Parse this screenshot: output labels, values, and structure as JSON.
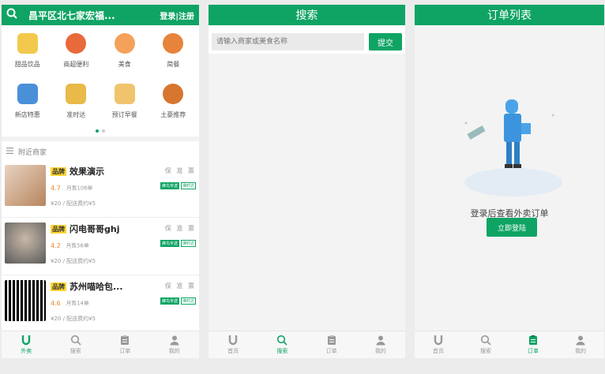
{
  "home": {
    "location": "昌平区北七家宏福...",
    "login_label": "登录|注册",
    "categories": [
      {
        "label": "甜品饮品",
        "color": "#f2c94c"
      },
      {
        "label": "商超便利",
        "color": "#e86a3a"
      },
      {
        "label": "美食",
        "color": "#f4a25b"
      },
      {
        "label": "简餐",
        "color": "#e7833b"
      },
      {
        "label": "新店特惠",
        "color": "#4a90d9"
      },
      {
        "label": "准时达",
        "color": "#e9b949"
      },
      {
        "label": "预订早餐",
        "color": "#f0c46d"
      },
      {
        "label": "土豪推荐",
        "color": "#d7762f"
      }
    ],
    "nearby_title": "附近商家",
    "brand_label": "品牌",
    "service_tags": "保 准 票",
    "shops": [
      {
        "name": "效果演示",
        "rating": "4.7",
        "sold": "月售106单",
        "fee": "¥20 / 配送费约¥5",
        "badge1": "蜂鸟专送",
        "badge2": "准时达",
        "thumb": "#c6a78d"
      },
      {
        "name": "闪电哥哥ghj",
        "rating": "4.2",
        "sold": "月售56单",
        "fee": "¥20 / 配送费约¥5",
        "badge1": "蜂鸟专送",
        "badge2": "准时达",
        "thumb": "#7d7d7d"
      },
      {
        "name": "苏州喵哈包...",
        "rating": "4.6",
        "sold": "月售14单",
        "fee": "¥20 / 配送费约¥5",
        "badge1": "蜂鸟专送",
        "badge2": "准时达",
        "thumb": "#222222"
      }
    ]
  },
  "search": {
    "title": "搜索",
    "placeholder": "请输入商家或美食名称",
    "submit_label": "提交"
  },
  "orders": {
    "title": "订单列表",
    "hint": "登录后查看外卖订单",
    "login_button": "立即登陆"
  },
  "tabbar_home": [
    "外卖",
    "搜索",
    "订单",
    "我的"
  ],
  "tabbar_other": [
    "首页",
    "搜索",
    "订单",
    "我的"
  ],
  "colors": {
    "accent": "#0fa464"
  }
}
